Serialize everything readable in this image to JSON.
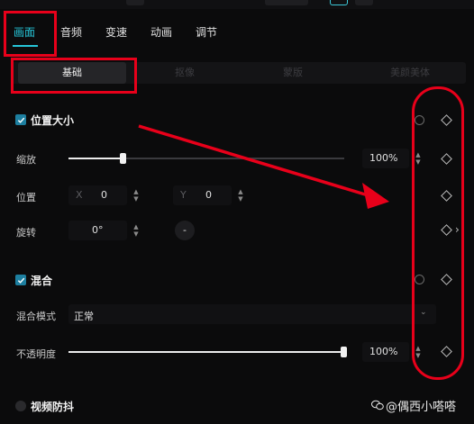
{
  "tabs": [
    {
      "label": "画面"
    },
    {
      "label": "音频"
    },
    {
      "label": "变速"
    },
    {
      "label": "动画"
    },
    {
      "label": "调节"
    }
  ],
  "subtabs": [
    {
      "label": "基础"
    },
    {
      "label": "抠像"
    },
    {
      "label": "蒙版"
    },
    {
      "label": "美颜美体"
    }
  ],
  "position_size": {
    "title": "位置大小",
    "scale_label": "缩放",
    "scale_value": "100%",
    "scale_level": 0.2,
    "position_label": "位置",
    "x_label": "X",
    "x_value": "0",
    "y_label": "Y",
    "y_value": "0",
    "rotate_label": "旋转",
    "rotate_value": "0°",
    "rotate_reset": "-"
  },
  "blend": {
    "title": "混合",
    "mode_label": "混合模式",
    "mode_value": "正常",
    "opacity_label": "不透明度",
    "opacity_value": "100%",
    "opacity_level": 1.0
  },
  "stabilize": {
    "title": "视频防抖"
  },
  "watermark": {
    "text": "@偶西小嗒嗒"
  },
  "colors": {
    "accent": "#26c6d9",
    "annotation_red": "#e8001a"
  }
}
